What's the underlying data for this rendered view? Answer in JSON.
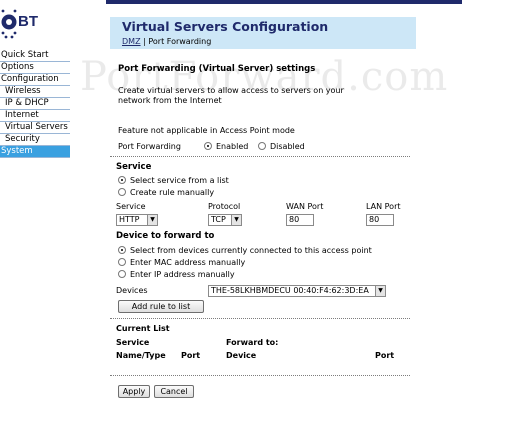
{
  "brand": {
    "logo_text": "BT",
    "color": "#1f2a6b",
    "accent": "#3aa0e0"
  },
  "nav": {
    "items": [
      {
        "label": "Quick Start",
        "level": 0,
        "active": false
      },
      {
        "label": "Options",
        "level": 0,
        "active": false
      },
      {
        "label": "Configuration",
        "level": 0,
        "active": false
      },
      {
        "label": "Wireless",
        "level": 1,
        "active": false
      },
      {
        "label": "IP & DHCP",
        "level": 1,
        "active": false
      },
      {
        "label": "Internet",
        "level": 1,
        "active": false
      },
      {
        "label": "Virtual Servers",
        "level": 1,
        "active": false
      },
      {
        "label": "Security",
        "level": 1,
        "active": false
      },
      {
        "label": "System",
        "level": 0,
        "active": true
      }
    ]
  },
  "header": {
    "title": "Virtual Servers Configuration",
    "crumb_dmz": "DMZ",
    "crumb_sep": "|",
    "crumb_pf": "Port Forwarding"
  },
  "watermark": "PortForward.com",
  "section": {
    "title": "Port Forwarding (Virtual Server) settings",
    "description": "Create virtual servers to allow access to servers on your network from the Internet"
  },
  "feature_note": "Feature not applicable in Access Point mode",
  "port_forwarding": {
    "label": "Port Forwarding",
    "enabled": "Enabled",
    "disabled": "Disabled"
  },
  "service": {
    "heading": "Service",
    "opt_list": "Select service from a list",
    "opt_manual": "Create rule manually",
    "col_service": "Service",
    "col_protocol": "Protocol",
    "col_wan": "WAN Port",
    "col_lan": "LAN Port",
    "service_value": "HTTP",
    "protocol_value": "TCP",
    "wan_value": "80",
    "lan_value": "80"
  },
  "device": {
    "heading": "Device to forward to",
    "opt_connected": "Select from devices currently connected to this access point",
    "opt_mac": "Enter MAC address manually",
    "opt_ip": "Enter IP address manually",
    "devices_label": "Devices",
    "devices_value": "THE-58LKHBMDECU 00:40:F4:62:3D:EA",
    "add_rule": "Add rule to list"
  },
  "current_list": {
    "heading": "Current List",
    "service": "Service",
    "forward_to": "Forward to:",
    "name_type": "Name/Type",
    "port": "Port",
    "device": "Device",
    "port2": "Port"
  },
  "actions": {
    "apply": "Apply",
    "cancel": "Cancel"
  }
}
